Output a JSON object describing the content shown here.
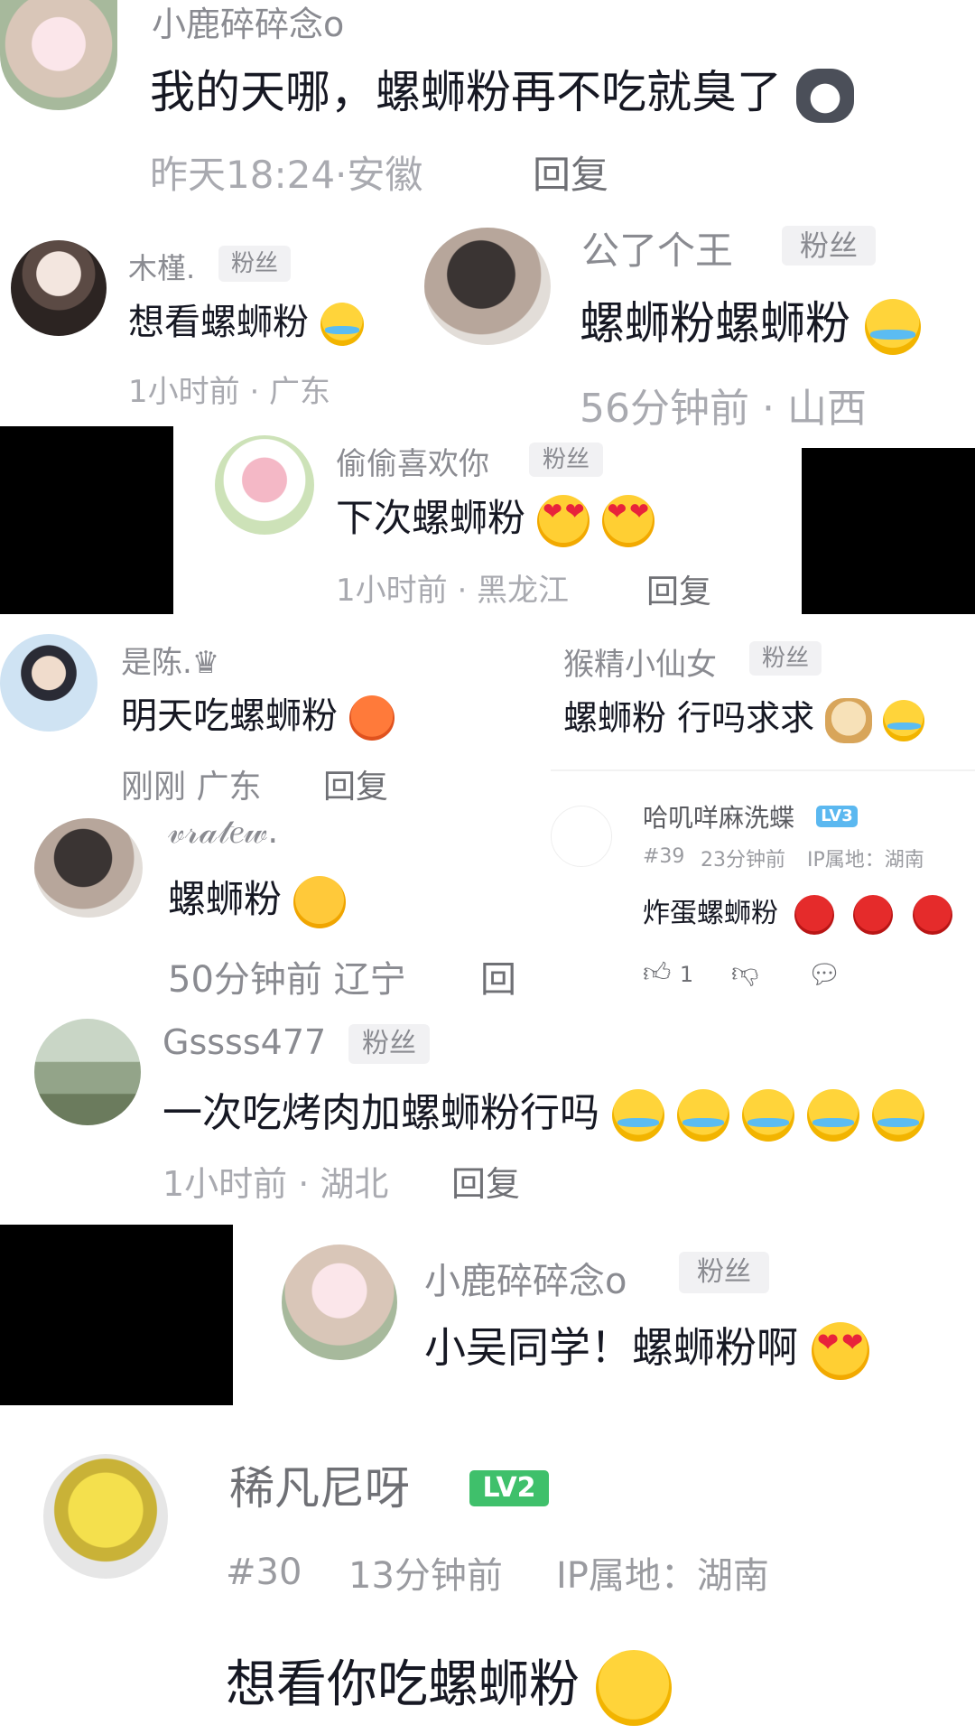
{
  "comments": [
    {
      "user": "小鹿碎碎念o",
      "text": "我的天哪，螺蛳粉再不吃就臭了",
      "time": "昨天18:24·安徽",
      "reply": "回复"
    },
    {
      "user": "木槿.",
      "badge": "粉丝",
      "text": "想看螺蛳粉",
      "time": "1小时前 · 广东"
    },
    {
      "user": "公了个王",
      "badge": "粉丝",
      "text": "螺蛳粉螺蛳粉",
      "time": "56分钟前 · 山西"
    },
    {
      "user": "偷偷喜欢你",
      "badge": "粉丝",
      "text": "下次螺蛳粉",
      "time": "1小时前 · 黑龙江",
      "reply": "回复"
    },
    {
      "user": "是陈.♛",
      "text": "明天吃螺蛳粉",
      "time": "刚刚 广东",
      "reply": "回复"
    },
    {
      "user": "猴精小仙女",
      "badge": "粉丝",
      "text": "螺蛳粉  行吗求求"
    },
    {
      "user": "哈叽咩麻洗蝶",
      "level": "LV3",
      "floor": "#39",
      "time": "23分钟前",
      "ip": "IP属地：湖南",
      "text": "炸蛋螺蛳粉",
      "likes": "1"
    },
    {
      "user": "𝓋𝓇𝒶𝓉𝑒𝓌.",
      "text": "螺蛳粉",
      "time": "50分钟前 辽宁",
      "reply": "回"
    },
    {
      "user": "Gssss477",
      "badge": "粉丝",
      "text": "一次吃烤肉加螺蛳粉行吗",
      "time": "1小时前 · 湖北",
      "reply": "回复"
    },
    {
      "user": "小鹿碎碎念o",
      "badge": "粉丝",
      "text": "小吴同学！螺蛳粉啊"
    },
    {
      "user": "稀凡尼呀",
      "level": "LV2",
      "floor": "#30",
      "time": "13分钟前",
      "ip": "IP属地：湖南",
      "text": "想看你吃螺蛳粉"
    }
  ],
  "icons": {
    "like": "thumb-up-icon",
    "dislike": "thumb-down-icon",
    "comment": "comment-bubble-icon"
  }
}
